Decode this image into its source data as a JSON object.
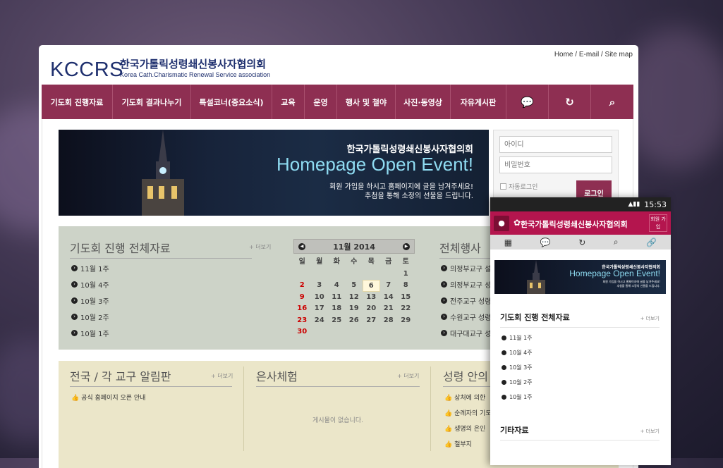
{
  "site": {
    "logo": "KCCRS",
    "title_ko": "한국가톨릭성령쇄신봉사자협의회",
    "title_en": "Korea Cath.Charismatic Renewal Service association"
  },
  "toplinks": {
    "home": "Home",
    "email": "E-mail",
    "sitemap": "Site map",
    "sep": " / "
  },
  "nav": [
    "기도회 진행자료",
    "기도회 결과나누기",
    "특설코너(중요소식)",
    "교육",
    "운영",
    "행사 및 철야",
    "사진·동영상",
    "자유게시판"
  ],
  "nav_icons": [
    "chat-icon",
    "refresh-icon",
    "search-icon"
  ],
  "banner": {
    "title": "한국가톨릭성령쇄신봉사자협의회",
    "event": "Homepage Open Event!",
    "line1": "회원 가입을 하시고 홈페이지에 글을 남겨주세요!",
    "line2": "추첨을 통해 소정의 선물을 드립니다."
  },
  "login": {
    "id_placeholder": "아이디",
    "pw_placeholder": "비밀번호",
    "autologin": "자동로그인",
    "button": "로그인"
  },
  "prayer": {
    "title": "기도회 진행 전체자료",
    "more": "+ 더보기",
    "items": [
      "11월 1주",
      "10월 4주",
      "10월 3주",
      "10월 2주",
      "10월 1주"
    ]
  },
  "calendar": {
    "month": "11월 2014",
    "weekdays": [
      "일",
      "월",
      "화",
      "수",
      "목",
      "금",
      "토"
    ],
    "rows": [
      [
        "",
        "",
        "",
        "",
        "",
        "",
        "1"
      ],
      [
        "2",
        "3",
        "4",
        "5",
        "6",
        "7",
        "8"
      ],
      [
        "9",
        "10",
        "11",
        "12",
        "13",
        "14",
        "15"
      ],
      [
        "16",
        "17",
        "18",
        "19",
        "20",
        "21",
        "22"
      ],
      [
        "23",
        "24",
        "25",
        "26",
        "27",
        "28",
        "29"
      ],
      [
        "30",
        "",
        "",
        "",
        "",
        "",
        ""
      ]
    ]
  },
  "events": {
    "title": "전체행사 ",
    "items": [
      "의정부교구 설",
      "의정부교구 성",
      "전주교구 성령",
      "수원교구 성령",
      "대구대교구 성"
    ]
  },
  "notice": {
    "title": "전국 / 각 교구 알림판",
    "more": "+ 더보기",
    "items": [
      "공식 홈페이지 오픈 안내"
    ]
  },
  "gift": {
    "title": "은사체험",
    "more": "+ 더보기",
    "empty": "게시물이 없습니다."
  },
  "spirit": {
    "title": "성령 안의",
    "items": [
      "상처에 의한 ",
      "순례자의 기도",
      "생명의 은인",
      "철부지"
    ]
  },
  "mobile": {
    "time": "15:53",
    "title": "한국가톨릭성령쇄신봉사자협의회",
    "join": "회원 가입",
    "banner_title": "한국가톨릭성령쇄신봉사자협의회",
    "banner_event": "Homepage Open Event!",
    "banner_sub1": "회원 가입을 하시고 홈페이지에 글을 남겨주세요!",
    "banner_sub2": "추첨을 통해 소정의 선물을 드립니다.",
    "section1": "기도회 진행 전체자료",
    "more": "+ 더보기",
    "items": [
      "11월 1주",
      "10월 4주",
      "10월 3주",
      "10월 2주",
      "10월 1주"
    ],
    "section2": "기타자료"
  },
  "colors": {
    "nav": "#8e2f52",
    "mobile_header": "#b4154e",
    "grey_panel": "#cdd3c8",
    "beige_panel": "#ebe6c9"
  }
}
